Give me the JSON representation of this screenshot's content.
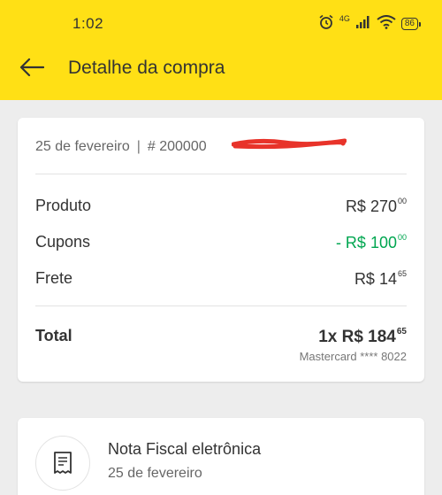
{
  "status_bar": {
    "time": "1:02",
    "network": "4G",
    "battery": "86",
    "icons": [
      "alarm-icon",
      "signal-icon",
      "wifi-icon",
      "battery-icon"
    ]
  },
  "header": {
    "back_icon": "arrow-left-icon",
    "title": "Detalhe da compra",
    "background_color": "#ffe015"
  },
  "purchase": {
    "date": "25 de fevereiro",
    "separator": "|",
    "order_number": "# 200000",
    "order_number_redacted": true,
    "rows": [
      {
        "label": "Produto",
        "value_main": "R$ 270",
        "value_cents": "00",
        "color": "#333333"
      },
      {
        "label": "Cupons",
        "value_main": "- R$ 100",
        "value_cents": "00",
        "color": "#00a650"
      },
      {
        "label": "Frete",
        "value_main": "R$ 14",
        "value_cents": "65",
        "color": "#333333"
      }
    ],
    "total": {
      "label": "Total",
      "value_main": "1x R$ 184",
      "value_cents": "65",
      "payment_method": "Mastercard **** 8022"
    }
  },
  "invoice": {
    "icon": "receipt-icon",
    "title": "Nota Fiscal eletrônica",
    "date": "25 de fevereiro"
  }
}
